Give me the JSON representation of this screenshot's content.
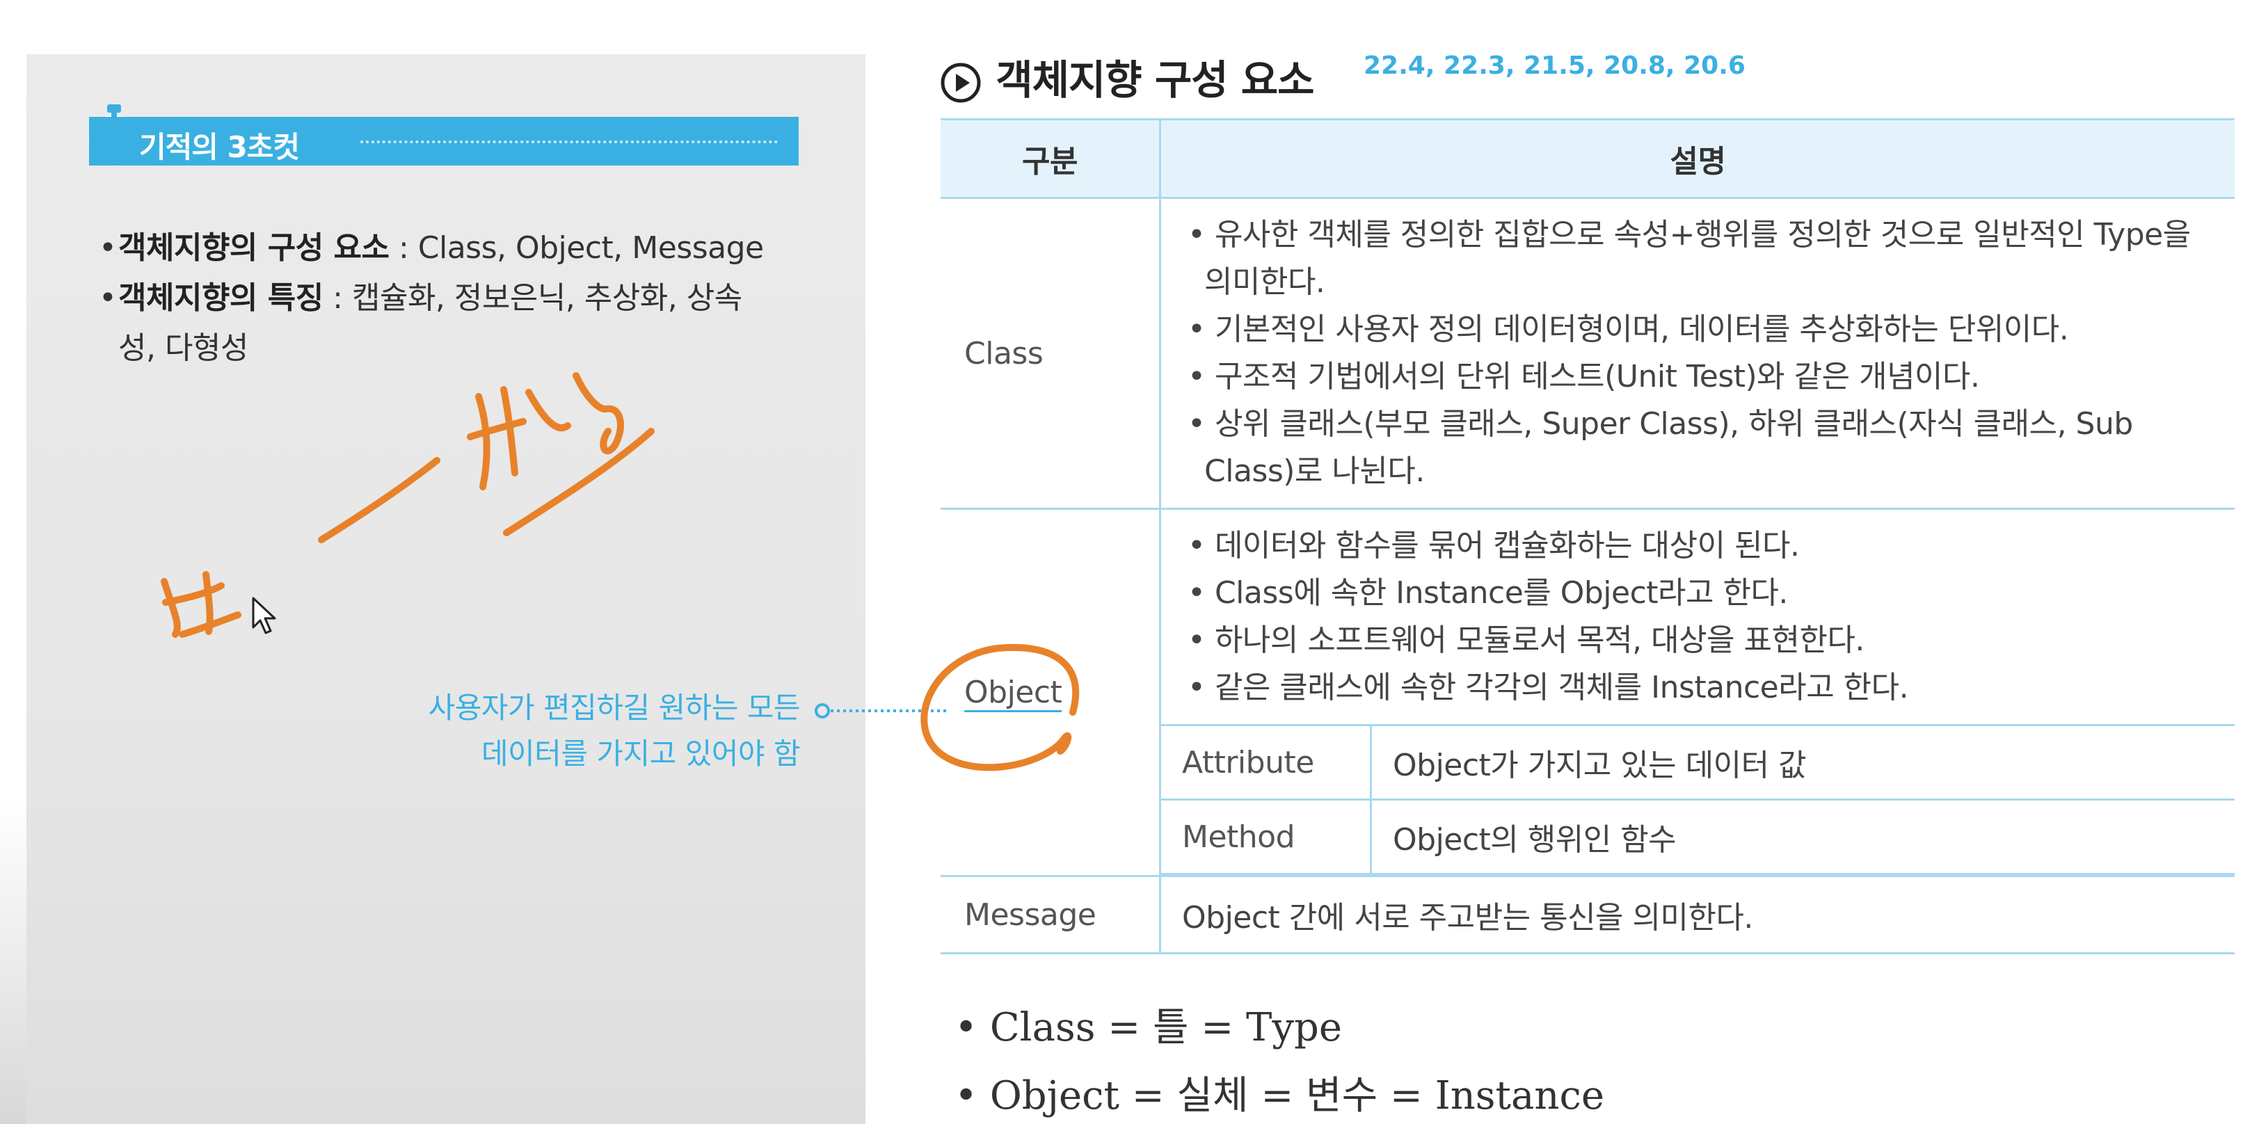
{
  "sidebar": {
    "banner_title": "기적의 3초컷",
    "summary": [
      {
        "term": "객체지향의 구성 요소",
        "detail": " : Class, Object, Message"
      },
      {
        "term": "객체지향의 특징",
        "detail": " : 캡슐화, 정보은닉, 추상화, 상속"
      },
      {
        "term": "",
        "detail": "성, 다형성"
      }
    ],
    "annotation_line1": "사용자가 편집하길 원하는 모든",
    "annotation_line2": "데이터를 가지고 있어야 함"
  },
  "section": {
    "title": "객체지향 구성 요소",
    "versions": "22.4, 22.3, 21.5, 20.8, 20.6"
  },
  "table": {
    "header_category": "구분",
    "header_description": "설명",
    "class_label": "Class",
    "class_items": [
      "• 유사한 객체를 정의한 집합으로 속성+행위를 정의한 것으로 일반적인 Type을 의미한다.",
      "• 기본적인 사용자 정의 데이터형이며, 데이터를 추상화하는 단위이다.",
      "• 구조적 기법에서의 단위 테스트(Unit Test)와 같은 개념이다.",
      "• 상위 클래스(부모 클래스, Super Class), 하위 클래스(자식 클래스, Sub Class)로 나뉜다."
    ],
    "object_label": "Object",
    "object_items": [
      "• 데이터와 함수를 묶어 캡슐화하는 대상이 된다.",
      "• Class에 속한 Instance를 Object라고 한다.",
      "• 하나의 소프트웨어 모듈로서 목적, 대상을 표현한다.",
      "• 같은 클래스에 속한 각각의 객체를 Instance라고 한다."
    ],
    "attribute_label": "Attribute",
    "attribute_value": "Object가 가지고 있는 데이터 값",
    "method_label": "Method",
    "method_value": "Object의 행위인 함수",
    "message_label": "Message",
    "message_value": "Object 간에 서로 주고받는 통신을 의미한다."
  },
  "formulas": [
    "• Class = 틀 = Type",
    "• Object = 실체 = 변수 = Instance"
  ],
  "colors": {
    "accent": "#3ab0e2",
    "table_border": "#a9d8ef",
    "header_bg": "#e4f3fb",
    "ink": "#e8822a"
  }
}
